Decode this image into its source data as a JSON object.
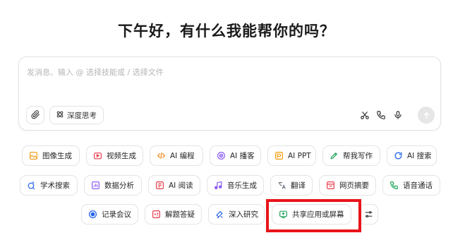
{
  "greeting": "下午好，有什么我能帮你的吗？",
  "composer": {
    "placeholder": "发消息、输入 @ 选择技能或 / 选择文件",
    "deep_think_label": "深度思考"
  },
  "colors": {
    "highlight": "#e8141b",
    "send_disabled": "#e6e6e6"
  },
  "skills": {
    "row1": [
      {
        "label": "图像生成",
        "icon": "image-gen-icon",
        "color": "#f0a020"
      },
      {
        "label": "视频生成",
        "icon": "video-gen-icon",
        "color": "#e83e4e"
      },
      {
        "label": "AI 编程",
        "icon": "code-icon",
        "color": "#f28a1e"
      },
      {
        "label": "AI 播客",
        "icon": "podcast-icon",
        "color": "#8b5cf6"
      },
      {
        "label": "AI PPT",
        "icon": "ppt-icon",
        "color": "#f59e0b"
      },
      {
        "label": "帮我写作",
        "icon": "pen-icon",
        "color": "#22a55c"
      },
      {
        "label": "AI 搜索",
        "icon": "search-icon",
        "color": "#2563eb"
      }
    ],
    "row2": [
      {
        "label": "学术搜索",
        "icon": "academic-icon",
        "color": "#2563eb"
      },
      {
        "label": "数据分析",
        "icon": "chart-icon",
        "color": "#8b5cf6"
      },
      {
        "label": "AI 阅读",
        "icon": "reading-icon",
        "color": "#e83e4e"
      },
      {
        "label": "音乐生成",
        "icon": "music-icon",
        "color": "#8b5cf6"
      },
      {
        "label": "翻译",
        "icon": "translate-icon",
        "color": "#6b7280"
      },
      {
        "label": "网页摘要",
        "icon": "web-summary-icon",
        "color": "#e83e4e"
      },
      {
        "label": "语音通话",
        "icon": "phone-icon",
        "color": "#22a55c"
      }
    ],
    "row3": [
      {
        "label": "记录会议",
        "icon": "record-icon",
        "color": "#2563eb"
      },
      {
        "label": "解题答疑",
        "icon": "solve-icon",
        "color": "#e83e4e"
      },
      {
        "label": "深入研究",
        "icon": "research-icon",
        "color": "#2563eb"
      },
      {
        "label": "共享应用或屏幕",
        "icon": "share-screen-icon",
        "color": "#22a55c"
      }
    ]
  }
}
